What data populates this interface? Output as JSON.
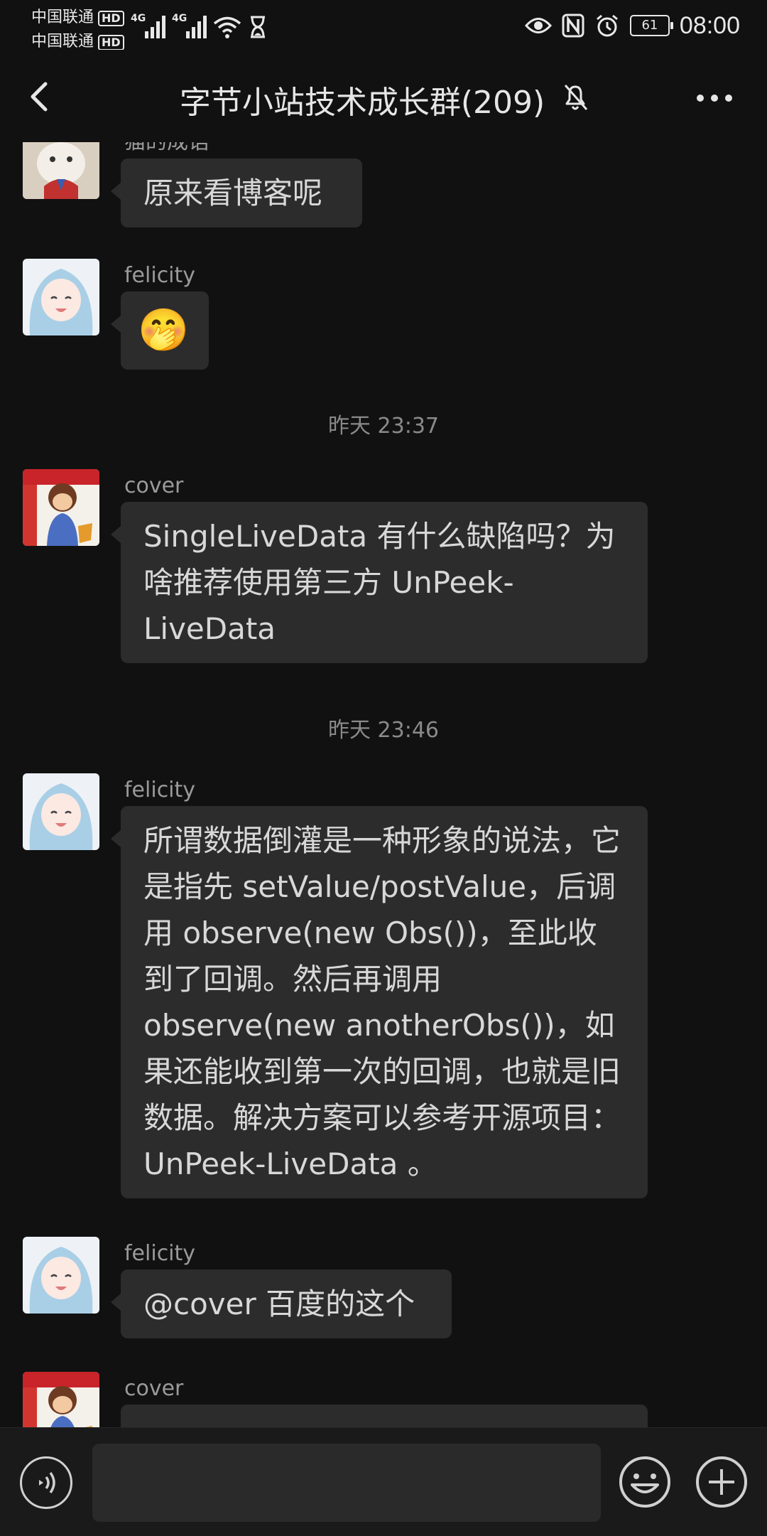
{
  "status_bar": {
    "carrier_1": "中国联通",
    "carrier_2": "中国联通",
    "hd_badge": "HD",
    "network_1": "4G",
    "network_2": "4G",
    "battery_level": "61",
    "time": "08:00"
  },
  "header": {
    "title": "字节小站技术成长群(209)"
  },
  "messages": [
    {
      "sender": "猫的成语",
      "text": "原来看博客呢"
    },
    {
      "sender": "felicity",
      "emoji": "🤭"
    },
    {
      "timestamp": "昨天 23:37"
    },
    {
      "sender": "cover",
      "text": "SingleLiveData 有什么缺陷吗？为啥推荐使用第三方 UnPeek-LiveData"
    },
    {
      "timestamp": "昨天 23:46"
    },
    {
      "sender": "felicity",
      "text": "所谓数据倒灌是一种形象的说法，它是指先 setValue/postValue，后调用 observe(new Obs())，至此收到了回调。然后再调用 observe(new anotherObs())，如果还能收到第一次的回调，也就是旧数据。解决方案可以参考开源项目：UnPeek-LiveData 。"
    },
    {
      "sender": "felicity",
      "text": "@cover  百度的这个"
    },
    {
      "sender": "cover",
      "text": ""
    }
  ],
  "input_bar": {
    "placeholder": ""
  },
  "icons": {
    "back": "back-arrow-icon",
    "mute": "bell-off-icon",
    "more": "more-dots-icon",
    "voice": "voice-input-icon",
    "emoji": "emoji-icon",
    "plus": "plus-icon"
  },
  "colors": {
    "background": "#111111",
    "bubble": "#2c2c2c",
    "text": "#d8d8d8",
    "secondary_text": "#9a9a9a"
  }
}
